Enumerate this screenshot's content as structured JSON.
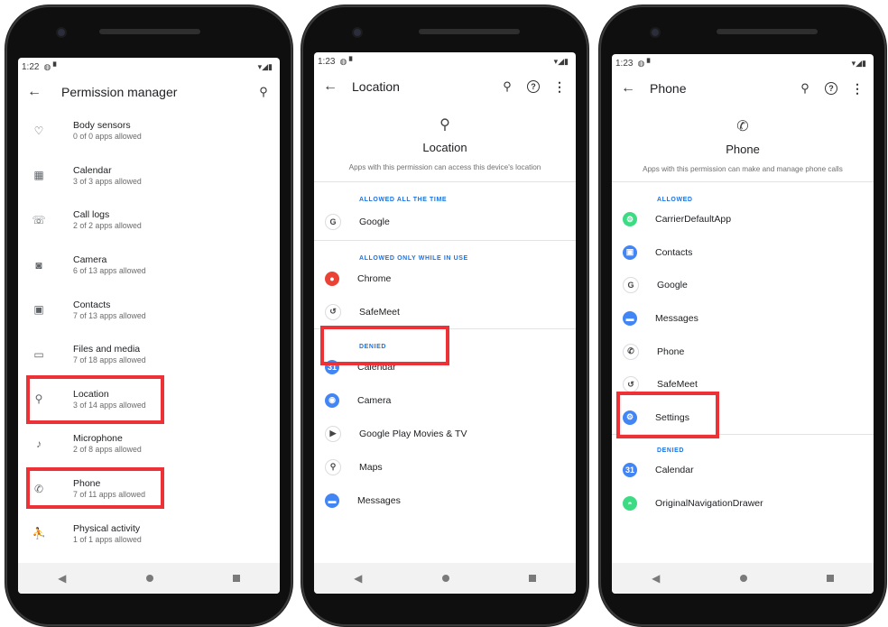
{
  "status": {
    "time1": "1:22",
    "time2": "1:23",
    "time3": "1:23"
  },
  "screen1": {
    "title": "Permission manager",
    "items": [
      {
        "icon": "heart-icon",
        "glyph": "♡",
        "label": "Body sensors",
        "sub": "0 of 0 apps allowed"
      },
      {
        "icon": "calendar-icon",
        "glyph": "▦",
        "label": "Calendar",
        "sub": "3 of 3 apps allowed"
      },
      {
        "icon": "call-log-icon",
        "glyph": "☏",
        "label": "Call logs",
        "sub": "2 of 2 apps allowed"
      },
      {
        "icon": "camera-icon",
        "glyph": "◙",
        "label": "Camera",
        "sub": "6 of 13 apps allowed"
      },
      {
        "icon": "contacts-icon",
        "glyph": "▣",
        "label": "Contacts",
        "sub": "7 of 13 apps allowed"
      },
      {
        "icon": "folder-icon",
        "glyph": "▭",
        "label": "Files and media",
        "sub": "7 of 18 apps allowed"
      },
      {
        "icon": "location-pin-icon",
        "glyph": "⚲",
        "label": "Location",
        "sub": "3 of 14 apps allowed"
      },
      {
        "icon": "microphone-icon",
        "glyph": "♪",
        "label": "Microphone",
        "sub": "2 of 8 apps allowed"
      },
      {
        "icon": "phone-icon",
        "glyph": "✆",
        "label": "Phone",
        "sub": "7 of 11 apps allowed"
      },
      {
        "icon": "activity-icon",
        "glyph": "⛹",
        "label": "Physical activity",
        "sub": "1 of 1 apps allowed"
      }
    ]
  },
  "screen2": {
    "title": "Location",
    "hero_title": "Location",
    "hero_desc": "Apps with this permission can access this device's location",
    "section_all_time": "ALLOWED ALL THE TIME",
    "section_while_in_use": "ALLOWED ONLY WHILE IN USE",
    "section_denied": "DENIED",
    "all_time": [
      {
        "name": "Google",
        "icon": "google-icon",
        "color": "#ffffff",
        "glyph": "G"
      }
    ],
    "while_in_use": [
      {
        "name": "Chrome",
        "icon": "chrome-icon",
        "color": "#ea4335",
        "glyph": "●"
      },
      {
        "name": "SafeMeet",
        "icon": "safemeet-icon",
        "color": "#ffffff",
        "glyph": "↺"
      }
    ],
    "denied": [
      {
        "name": "Calendar",
        "icon": "calendar-app-icon",
        "color": "#4285f4",
        "glyph": "31"
      },
      {
        "name": "Camera",
        "icon": "camera-app-icon",
        "color": "#4285f4",
        "glyph": "◉"
      },
      {
        "name": "Google Play Movies & TV",
        "icon": "play-movies-icon",
        "color": "#ffffff",
        "glyph": "▶"
      },
      {
        "name": "Maps",
        "icon": "maps-icon",
        "color": "#ffffff",
        "glyph": "⚲"
      },
      {
        "name": "Messages",
        "icon": "messages-icon",
        "color": "#4285f4",
        "glyph": "▬"
      }
    ]
  },
  "screen3": {
    "title": "Phone",
    "hero_title": "Phone",
    "hero_desc": "Apps with this permission can make and manage phone calls",
    "section_allowed": "ALLOWED",
    "section_denied": "DENIED",
    "allowed": [
      {
        "name": "CarrierDefaultApp",
        "icon": "carrier-app-icon",
        "color": "#3ddc84",
        "glyph": "⚙"
      },
      {
        "name": "Contacts",
        "icon": "contacts-app-icon",
        "color": "#4285f4",
        "glyph": "▣"
      },
      {
        "name": "Google",
        "icon": "google-icon",
        "color": "#ffffff",
        "glyph": "G"
      },
      {
        "name": "Messages",
        "icon": "messages-icon",
        "color": "#4285f4",
        "glyph": "▬"
      },
      {
        "name": "Phone",
        "icon": "phone-app-icon",
        "color": "#ffffff",
        "glyph": "✆"
      },
      {
        "name": "SafeMeet",
        "icon": "safemeet-icon",
        "color": "#ffffff",
        "glyph": "↺"
      },
      {
        "name": "Settings",
        "icon": "settings-icon",
        "color": "#4285f4",
        "glyph": "⚙"
      }
    ],
    "denied": [
      {
        "name": "Calendar",
        "icon": "calendar-app-icon",
        "color": "#4285f4",
        "glyph": "31"
      },
      {
        "name": "OriginalNavigationDrawer",
        "icon": "android-app-icon",
        "color": "#3ddc84",
        "glyph": "◓"
      }
    ]
  },
  "colors": {
    "highlight": "#ec3236",
    "accent": "#1a73e8"
  }
}
